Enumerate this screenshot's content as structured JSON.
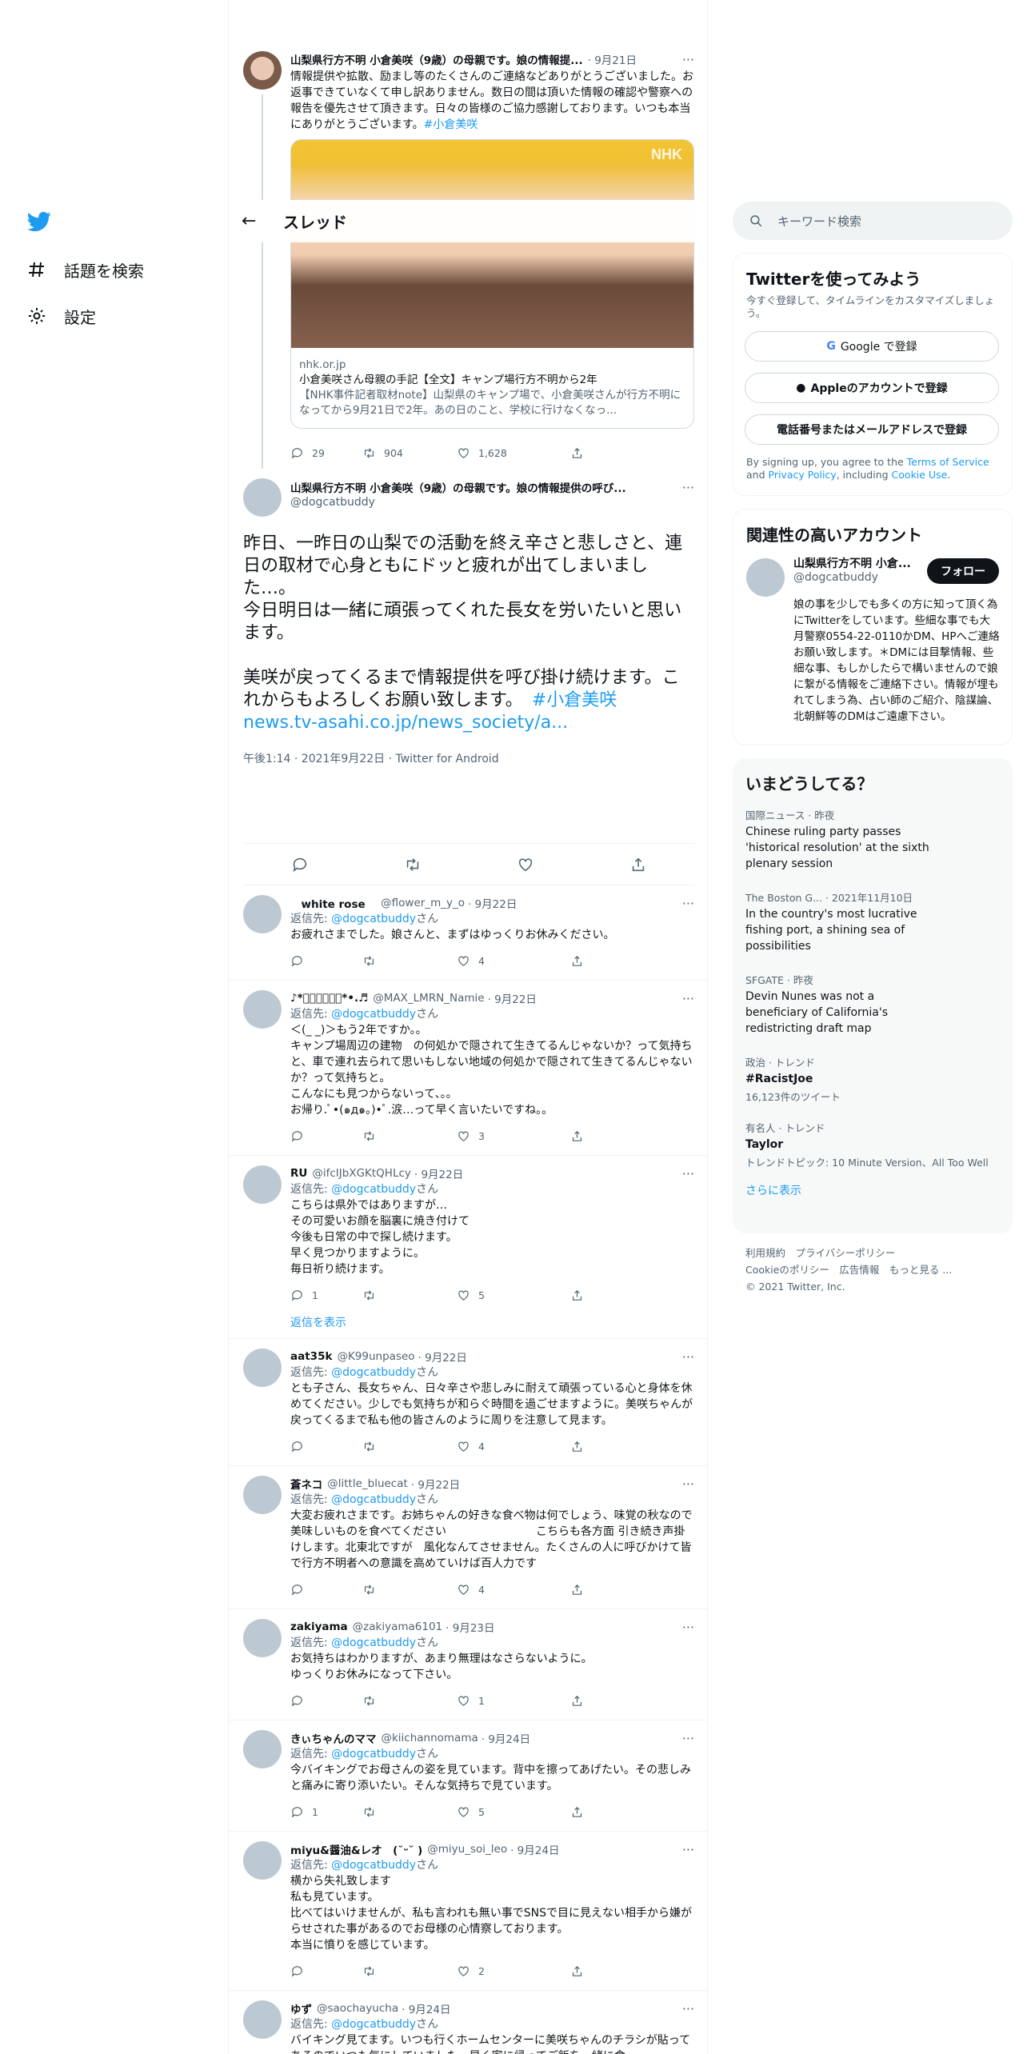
{
  "nav": {
    "explore": "話題を検索",
    "settings": "設定"
  },
  "thread_header": {
    "title": "スレッド"
  },
  "prev_tweet": {
    "name": "山梨県行方不明 小倉美咲（9歳）の母親です。娘の情報提...",
    "date": "· 9月21日",
    "text": "情報提供や拡散、励まし等のたくさんのご連絡などありがとうございました。お返事できていなくて申し訳ありません。数日の間は頂いた情報の確認や警察への報告を優先させて頂きます。日々の皆様のご協力感謝しております。いつも本当にありがとうございます。",
    "hashtag": "#小倉美咲",
    "card_domain": "nhk.or.jp",
    "card_title": "小倉美咲さん母親の手記【全文】キャンプ場行方不明から2年",
    "card_desc": "【NHK事件記者取材note】山梨県のキャンプ場で、小倉美咲さんが行方不明になってから9月21日で2年。あの日のこと、学校に行けなくなっ...",
    "image_badge": "NHK",
    "replies": "29",
    "retweets": "904",
    "likes": "1,628"
  },
  "main_tweet": {
    "name": "山梨県行方不明 小倉美咲（9歳）の母親です。娘の情報提供の呼び...",
    "handle": "@dogcatbuddy",
    "text": "昨日、一昨日の山梨での活動を終え辛さと悲しさと、連日の取材で心身ともにドッと疲れが出てしまいました…。\n今日明日は一緒に頑張ってくれた長女を労いたいと思います。\n\n美咲が戻ってくるまで情報提供を呼び掛け続けます。これからもよろしくお願い致します。　",
    "hashtag": "#小倉美咲",
    "link": "news.tv-asahi.co.jp/news_society/a...",
    "meta": "午後1:14 · 2021年9月22日 · Twitter for Android"
  },
  "reply_prefix": "返信先: ",
  "reply_target": "@dogcatbuddy",
  "reply_suffix": "さん",
  "show_replies": "返信を表示",
  "replies": [
    {
      "name": "　white rose　",
      "handle": "@flower_m_y_o",
      "date": "· 9月22日",
      "text": "お疲れさまでした。娘さんと、まずはゆっくりお休みください。",
      "reply": "",
      "rt": "",
      "like": "4"
    },
    {
      "name": "♪*ﾟ𝑵𝒂𝒐𝒎𝒊*•.♬",
      "handle": "@MAX_LMRN_Namie",
      "date": "· 9月22日",
      "text": "＜(_ _)＞もう2年ですか。。\nキャンプ場周辺の建物　の何処かで隠されて生きてるんじゃないか？って気持ちと、車で連れ去られて思いもしない地域の何処かで隠されて生きてるんじゃないか？って気持ちと。\nこんなにも見つからないって、。。\nお帰り.ﾟ•(๑д๑。)•ﾟ.涙…って早く言いたいですね。。",
      "reply": "",
      "rt": "",
      "like": "3"
    },
    {
      "name": "RU",
      "handle": "@ifcIJbXGKtQHLcy",
      "date": "· 9月22日",
      "text": "こちらは県外ではありますが…\nその可愛いお顔を脳裏に焼き付けて\n今後も日常の中で探し続けます。\n早く見つかりますように。\n毎日祈り続けます。",
      "reply": "1",
      "rt": "",
      "like": "5"
    },
    {
      "name": "aat35k",
      "handle": "@K99unpaseo",
      "date": "· 9月22日",
      "text": "とも子さん、長女ちゃん、日々辛さや悲しみに耐えて頑張っている心と身体を休めてください。少しでも気持ちが和らぐ時間を過ごせますように。美咲ちゃんが戻ってくるまで私も他の皆さんのように周りを注意して見ます。",
      "reply": "",
      "rt": "",
      "like": "4"
    },
    {
      "name": "蒼ネコ",
      "handle": "@little_bluecat",
      "date": "· 9月22日",
      "text": "大変お疲れさまです。お姉ちゃんの好きな食べ物は何でしょう、味覚の秋なので美味しいものを食べてください　　　　　　　　こちらも各方面 引き続き声掛けします。北東北ですが　風化なんてさせません。たくさんの人に呼びかけて皆で行方不明者への意識を高めていけば百人力です",
      "reply": "",
      "rt": "",
      "like": "4"
    },
    {
      "name": "zakiyama",
      "handle": "@zakiyama6101",
      "date": "· 9月23日",
      "text": "お気持ちはわかりますが、あまり無理はなさらないように。\nゆっくりお休みになって下さい。",
      "reply": "",
      "rt": "",
      "like": "1"
    },
    {
      "name": "きぃちゃんのママ",
      "handle": "@kiichannomama",
      "date": "· 9月24日",
      "text": "今バイキングでお母さんの姿を見ています。背中を擦ってあげたい。その悲しみと痛みに寄り添いたい。そんな気持ちで見ています。",
      "reply": "1",
      "rt": "",
      "like": "5"
    },
    {
      "name": "miyu&醤油&レオ　(˘ᵕ˘ )",
      "handle": "@miyu_soi_leo",
      "date": "· 9月24日",
      "text": "横から失礼致します\n私も見ています。\n比べてはいけませんが、私も言われも無い事でSNSで目に見えない相手から嫌がらせされた事があるのでお母様の心情察しております。\n本当に憤りを感じています。",
      "reply": "",
      "rt": "",
      "like": "2"
    },
    {
      "name": "ゆず",
      "handle": "@saochayucha",
      "date": "· 9月24日",
      "text": "バイキング見てます。いつも行くホームセンターに美咲ちゃんのチラシが貼ってあるのでいつも気にしていました。早く家に帰ってご飯を一緒に食",
      "reply": "",
      "rt": "",
      "like": ""
    }
  ],
  "right": {
    "search_placeholder": "キーワード検索",
    "signup": {
      "title": "Twitterを使ってみよう",
      "subtitle": "今すぐ登録して、タイムラインをカスタマイズしましょう。",
      "google": "Google で登録",
      "apple": "Appleのアカウントで登録",
      "phone": "電話番号またはメールアドレスで登録",
      "terms_pre": "By signing up, you agree to the ",
      "terms": "Terms of Service",
      "terms_and": " and ",
      "privacy": "Privacy Policy",
      "terms_inc": ", including ",
      "cookie": "Cookie Use",
      "terms_end": "."
    },
    "related": {
      "title": "関連性の高いアカウント",
      "name": "山梨県行方不明 小倉...",
      "handle": "@dogcatbuddy",
      "follow": "フォロー",
      "bio": "娘の事を少しでも多くの方に知って頂く為にTwitterをしています。些細な事でも大月警察0554-22-0110かDM、HPへご連絡お願い致します。＊DMには目撃情報、些細な事、もしかしたらで構いませんので娘に繋がる情報をご連絡下さい。情報が埋もれてしまう為、占い師のご紹介、陰謀論、北朝鮮等のDMはご遠慮下さい。"
    },
    "trends": {
      "title": "いまどうしてる？",
      "items": [
        {
          "cat": "国際ニュース · 昨夜",
          "title": "Chinese ruling party passes 'historical resolution' at the sixth plenary session",
          "count": ""
        },
        {
          "cat": "The Boston G... · 2021年11月10日",
          "title": "In the country's most lucrative fishing port, a shining sea of possibilities",
          "count": ""
        },
        {
          "cat": "SFGATE · 昨夜",
          "title": "Devin Nunes was not a beneficiary of California's redistricting draft map",
          "count": ""
        },
        {
          "cat": "政治 · トレンド",
          "title": "#RacistJoe",
          "count": "16,123件のツイート"
        },
        {
          "cat": "有名人 · トレンド",
          "title": "Taylor",
          "count": "トレンドトピック: 10 Minute Version、All Too Well"
        }
      ],
      "show_more": "さらに表示"
    },
    "footer": {
      "line1": "利用規約　プライバシーポリシー",
      "line2": "Cookieのポリシー　広告情報　もっと見る ...",
      "line3": "© 2021 Twitter, Inc."
    }
  }
}
